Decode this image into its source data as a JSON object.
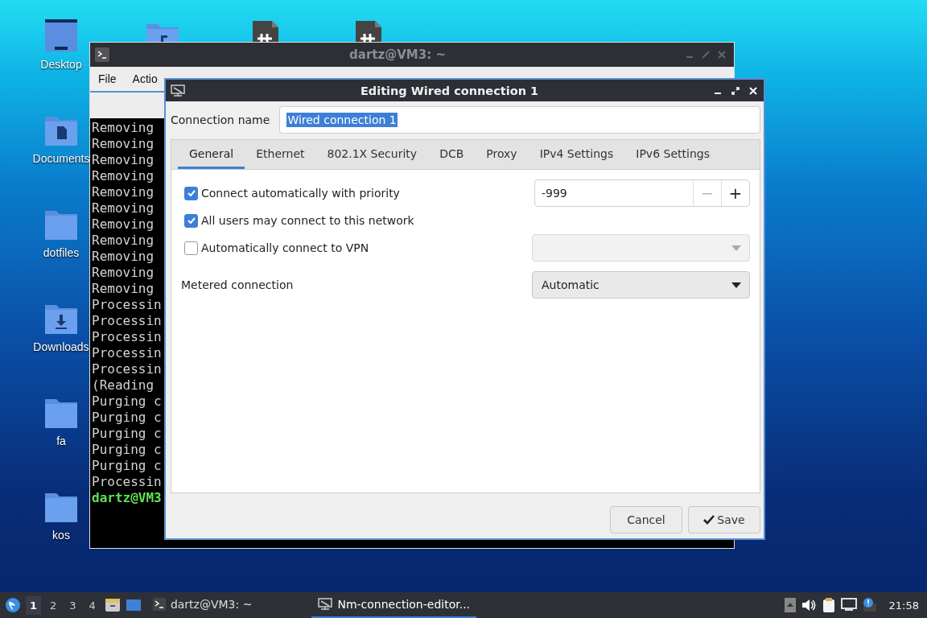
{
  "desktop": {
    "icons": [
      {
        "label": "Desktop",
        "kind": "desktop"
      },
      {
        "label": "Documents",
        "kind": "folder-doc"
      },
      {
        "label": "dotfiles",
        "kind": "folder"
      },
      {
        "label": "Downloads",
        "kind": "folder-download"
      },
      {
        "label": "fa",
        "kind": "folder"
      },
      {
        "label": "kos",
        "kind": "folder"
      }
    ],
    "top_icons": [
      {
        "kind": "folder-music"
      },
      {
        "kind": "spreadsheet"
      },
      {
        "kind": "spreadsheet"
      }
    ]
  },
  "terminal": {
    "title": "dartz@VM3: ~",
    "menu": [
      "File",
      "Actio"
    ],
    "lines": [
      {
        "text": "Removing",
        "kind": "output"
      },
      {
        "text": "Removing",
        "kind": "output"
      },
      {
        "text": "Removing",
        "kind": "output"
      },
      {
        "text": "Removing",
        "kind": "output"
      },
      {
        "text": "Removing",
        "kind": "output"
      },
      {
        "text": "Removing",
        "kind": "output"
      },
      {
        "text": "Removing",
        "kind": "output"
      },
      {
        "text": "Removing",
        "kind": "output"
      },
      {
        "text": "Removing",
        "kind": "output"
      },
      {
        "text": "Removing",
        "kind": "output"
      },
      {
        "text": "Removing",
        "kind": "output"
      },
      {
        "text": "Processin",
        "kind": "output"
      },
      {
        "text": "Processin",
        "kind": "output"
      },
      {
        "text": "Processin",
        "kind": "output"
      },
      {
        "text": "Processin",
        "kind": "output"
      },
      {
        "text": "Processin",
        "kind": "output"
      },
      {
        "text": "(Reading",
        "kind": "output"
      },
      {
        "text": "Purging c",
        "kind": "output"
      },
      {
        "text": "Purging c",
        "kind": "output"
      },
      {
        "text": "Purging c",
        "kind": "output"
      },
      {
        "text": "Purging c",
        "kind": "output"
      },
      {
        "text": "Purging c",
        "kind": "output"
      },
      {
        "text": "Processin",
        "kind": "output"
      },
      {
        "text": "dartz@VM3",
        "kind": "prompt"
      }
    ]
  },
  "dialog": {
    "title": "Editing Wired connection 1",
    "connection_name": {
      "label": "Connection name",
      "value": "Wired connection 1",
      "selected": true
    },
    "tabs": [
      {
        "label": "General",
        "selected": true
      },
      {
        "label": "Ethernet",
        "selected": false
      },
      {
        "label": "802.1X Security",
        "selected": false
      },
      {
        "label": "DCB",
        "selected": false
      },
      {
        "label": "Proxy",
        "selected": false
      },
      {
        "label": "IPv4 Settings",
        "selected": false
      },
      {
        "label": "IPv6 Settings",
        "selected": false
      }
    ],
    "options": [
      {
        "kind": "checkbox",
        "label": "Connect automatically with priority",
        "checked": true,
        "control": {
          "kind": "spin",
          "value": "-999",
          "minus": "−",
          "plus": "+"
        }
      },
      {
        "kind": "checkbox",
        "label": "All users may connect to this network",
        "checked": true
      },
      {
        "kind": "checkbox",
        "label": "Automatically connect to VPN",
        "checked": false,
        "control": {
          "kind": "dropdown",
          "disabled": true
        }
      },
      {
        "kind": "label",
        "label": "Metered connection",
        "control": {
          "kind": "dropdown",
          "value": "Automatic",
          "disabled": false
        }
      }
    ],
    "buttons": [
      {
        "label": "Cancel",
        "kind": "plain"
      },
      {
        "label": "Save",
        "kind": "confirm"
      }
    ]
  },
  "taskbar": {
    "workspaces": [
      {
        "label": "1",
        "selected": true
      },
      {
        "label": "2",
        "selected": false
      },
      {
        "label": "3",
        "selected": false
      },
      {
        "label": "4",
        "selected": false
      }
    ],
    "tasks": [
      {
        "label": "dartz@VM3: ~",
        "kind": "terminal",
        "selected": false
      },
      {
        "label": "Nm-connection-editor...",
        "kind": "network",
        "selected": true
      }
    ],
    "clock": "21:58"
  }
}
